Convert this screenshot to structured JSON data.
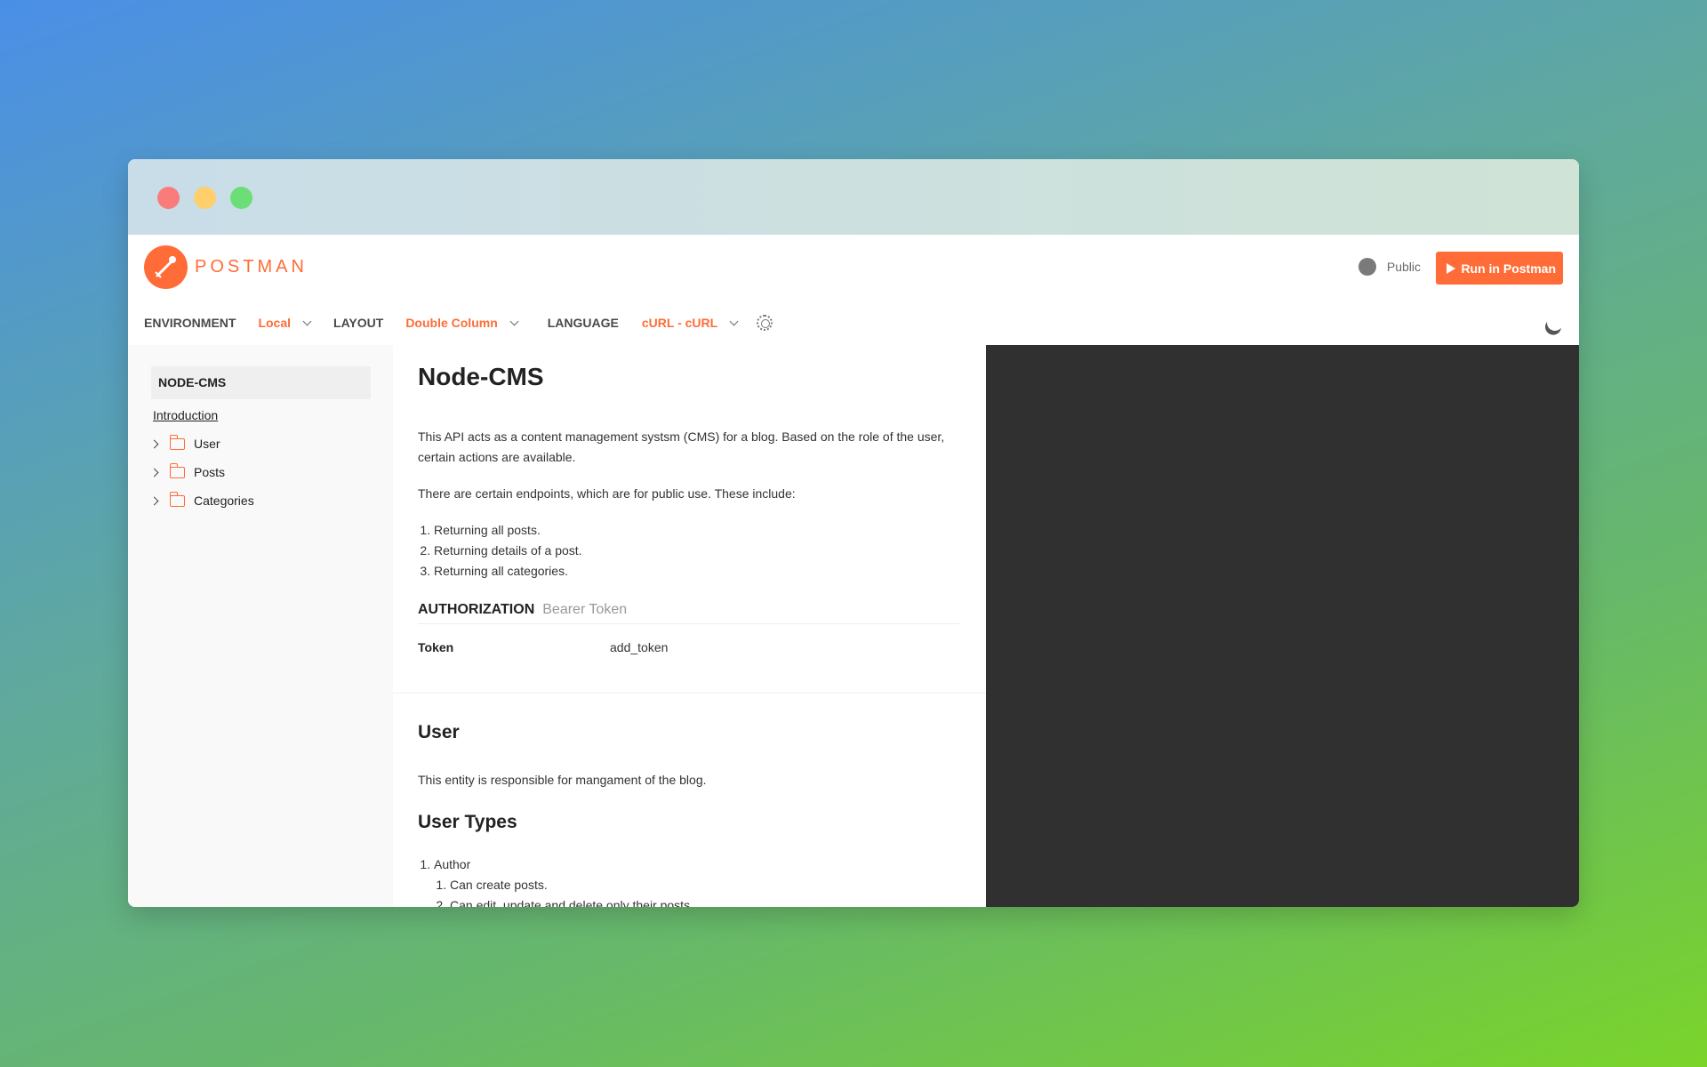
{
  "brand": {
    "name": "POSTMAN",
    "color": "#ff6c37"
  },
  "header": {
    "visibility_label": "Public",
    "run_button_label": "Run in Postman"
  },
  "toolbar": {
    "environment_label": "ENVIRONMENT",
    "environment_value": "Local",
    "layout_label": "LAYOUT",
    "layout_value": "Double Column",
    "language_label": "LANGUAGE",
    "language_value": "cURL - cURL"
  },
  "sidebar": {
    "collection_title": "NODE-CMS",
    "intro_link": "Introduction",
    "folders": [
      {
        "label": "User"
      },
      {
        "label": "Posts"
      },
      {
        "label": "Categories"
      }
    ]
  },
  "doc": {
    "title": "Node-CMS",
    "description": "This API acts as a content management systsm (CMS) for a blog. Based on the role of the user, certain actions are available.",
    "public_intro": "There are certain endpoints, which are for public use. These include:",
    "public_endpoints": [
      "Returning all posts.",
      "Returning details of a post.",
      "Returning all categories."
    ],
    "authorization": {
      "title": "AUTHORIZATION",
      "type": "Bearer Token",
      "key": "Token",
      "value": "add_token"
    },
    "user_section": {
      "title": "User",
      "description": "This entity is responsible for mangament of the blog.",
      "types_title": "User Types",
      "types": [
        {
          "name": "Author",
          "abilities": [
            "Can create posts.",
            "Can edit, update and delete only their posts"
          ]
        }
      ]
    }
  }
}
